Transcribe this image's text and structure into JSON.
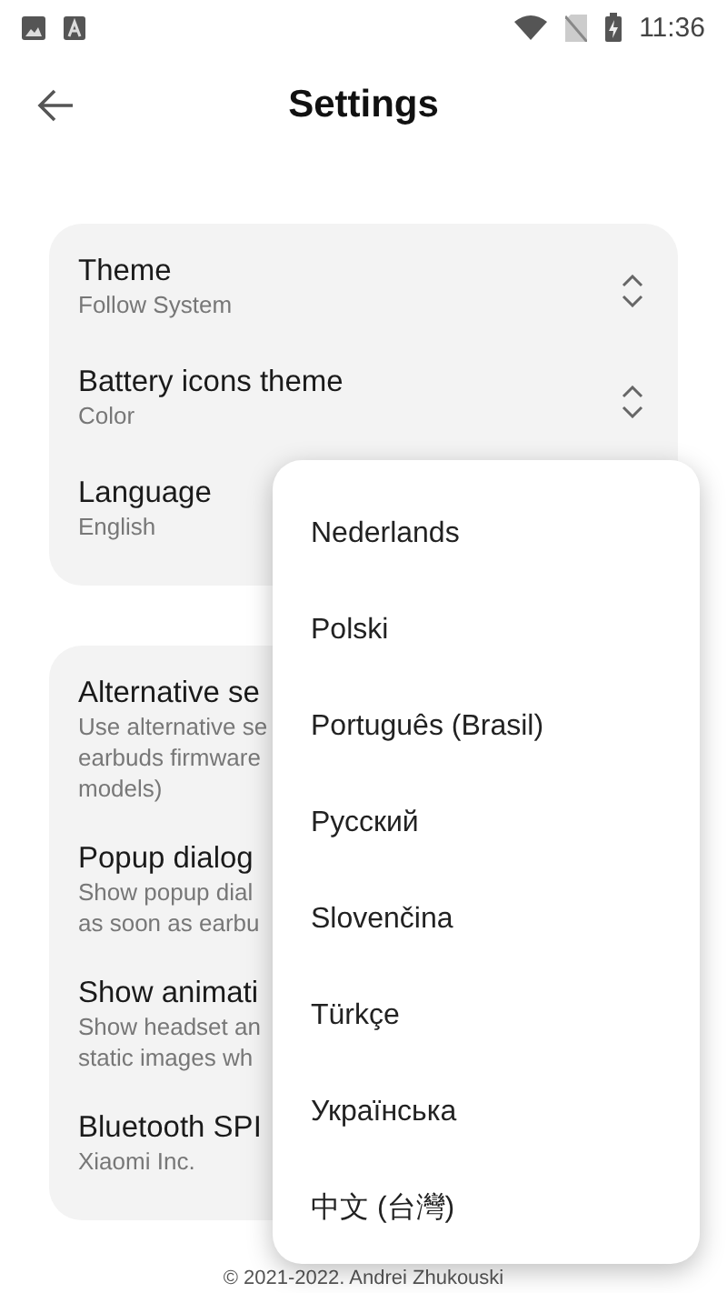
{
  "status_bar": {
    "time": "11:36"
  },
  "header": {
    "title": "Settings"
  },
  "sections": [
    {
      "items": [
        {
          "title": "Theme",
          "subtitle": [
            "Follow System"
          ],
          "chevron": true
        },
        {
          "title": "Battery icons theme",
          "subtitle": [
            "Color"
          ],
          "chevron": true
        },
        {
          "title": "Language",
          "subtitle": [
            "English"
          ]
        }
      ]
    },
    {
      "items": [
        {
          "title": "Alternative se",
          "subtitle": [
            "Use alternative se",
            "earbuds firmware",
            "models)"
          ]
        },
        {
          "title": "Popup dialog",
          "subtitle": [
            "Show popup dial",
            "as soon as earbu"
          ]
        },
        {
          "title": "Show animati",
          "subtitle": [
            "Show headset an",
            "static images wh"
          ]
        },
        {
          "title": "Bluetooth SPI",
          "subtitle": [
            "Xiaomi Inc."
          ]
        }
      ]
    }
  ],
  "footer": "© 2021-2022. Andrei Zhukouski",
  "language_menu": {
    "options": [
      "Nederlands",
      "Polski",
      "Português (Brasil)",
      "Русский",
      "Slovenčina",
      "Türkçe",
      "Українська",
      "中文 (台灣)"
    ]
  }
}
